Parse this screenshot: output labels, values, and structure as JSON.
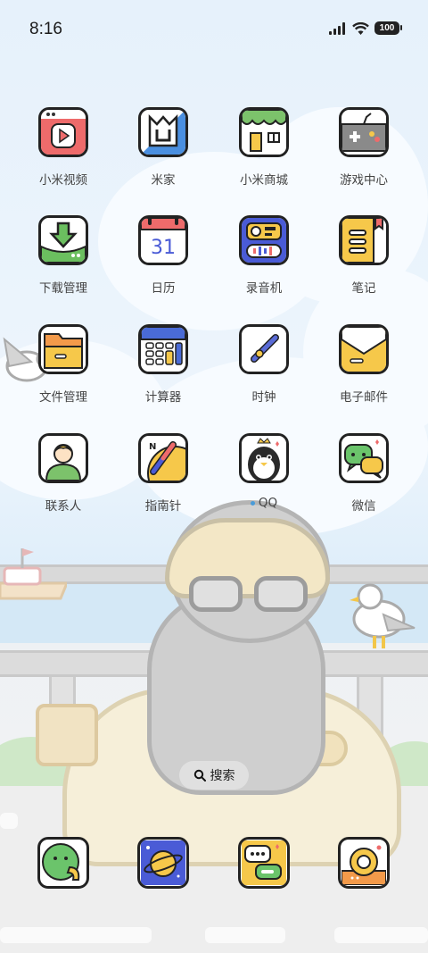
{
  "status_bar": {
    "time": "8:16",
    "battery": "100",
    "icons": [
      "signal-icon",
      "wifi-icon",
      "battery-icon"
    ]
  },
  "apps": [
    {
      "label": "小米视频",
      "icon": "video-play-icon",
      "color": "#ee6b6b"
    },
    {
      "label": "米家",
      "icon": "mijia-icon",
      "color": "#4a8fe0"
    },
    {
      "label": "小米商城",
      "icon": "store-icon",
      "color": "#7cc26b"
    },
    {
      "label": "游戏中心",
      "icon": "gamepad-icon",
      "color": "#8a8a8a"
    },
    {
      "label": "下载管理",
      "icon": "download-icon",
      "color": "#6bbf5f"
    },
    {
      "label": "日历",
      "icon": "calendar-icon",
      "color": "#ee6b6b",
      "day": "31"
    },
    {
      "label": "录音机",
      "icon": "recorder-icon",
      "color": "#4a5bd6"
    },
    {
      "label": "笔记",
      "icon": "notes-icon",
      "color": "#f6c84a"
    },
    {
      "label": "文件管理",
      "icon": "folder-icon",
      "color": "#f3b34a"
    },
    {
      "label": "计算器",
      "icon": "calculator-icon",
      "color": "#4a6bd6"
    },
    {
      "label": "时钟",
      "icon": "clock-icon",
      "color": "#5a6bd6"
    },
    {
      "label": "电子邮件",
      "icon": "mail-icon",
      "color": "#f6c84a"
    },
    {
      "label": "联系人",
      "icon": "contacts-icon",
      "color": "#7cc26b"
    },
    {
      "label": "指南针",
      "icon": "compass-icon",
      "color": "#f6c84a"
    },
    {
      "label": "QQ",
      "icon": "qq-penguin-icon",
      "color": "#222222",
      "badge_dot": true
    },
    {
      "label": "微信",
      "icon": "wechat-icon",
      "color": "#6bc46b"
    }
  ],
  "search": {
    "label": "搜索"
  },
  "dock": [
    {
      "icon": "phone-icon",
      "color": "#6bc46b"
    },
    {
      "icon": "browser-icon",
      "color": "#4a5bd6"
    },
    {
      "icon": "messages-icon",
      "color": "#f6c84a"
    },
    {
      "icon": "camera-icon",
      "color": "#f39a4a"
    }
  ]
}
